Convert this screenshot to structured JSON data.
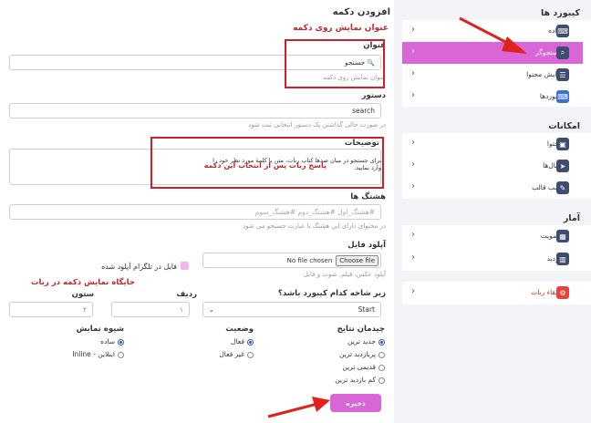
{
  "page": {
    "title": "افزودن دکمه"
  },
  "form": {
    "section_title": "عنوان نمایش روی دکمه",
    "title_label": "عنوان",
    "title_value": "جستجو",
    "title_emoji": "🔍",
    "title_hint": "عنوان نمایش روی دکمه",
    "command_label": "دستور",
    "command_value": "search",
    "command_hint": "در صورت خالی گذاشتن یک دستور انتخابی ثبت شود",
    "desc_label": "توضیحات",
    "desc_value": "برای جستجو در میان صدها کتاب ربات، متن یا کلمهٔ مورد نظر خود را وارد نمایید.",
    "desc_annotation": "پاسخ ربات پس از انتخاب این دکمه",
    "hashtag_label": "هشتگ ها",
    "hashtag_placeholder": "#هشتگ_اول #هشتگ_دوم #هشتگ_سوم",
    "hashtag_hint": "در محتوای دارای این هشتگ یا عبارت جستجو می شود",
    "upload_label": "آپلود فایل",
    "upload_button": "Choose file",
    "upload_status": "No file chosen",
    "upload_hint": "آپلود عکس، فیلم، صوت و فایل",
    "telegram_checkbox": "فایل در تلگرام آپلود شده",
    "subbranch_label": "زیر شاخه کدام کیبورد باشد؟",
    "subbranch_value": "Start",
    "position_annotation": "جایگاه نمایش دکمه در ربات",
    "row_label": "ردیف",
    "row_value": "۱",
    "col_label": "ستون",
    "col_value": "۲",
    "sort_label": "چیدمان نتایج",
    "sort_options": [
      "جدید ترین",
      "پربازدید ترین",
      "قدیمی ترین",
      "کم بازدید ترین"
    ],
    "status_label": "وضعیت",
    "status_options": [
      "فعال",
      "غیر فعال"
    ],
    "display_label": "شیوه نمایش",
    "display_options": [
      "ساده",
      "اینلاین - Inline"
    ],
    "save_button": "ذخیره"
  },
  "sidebar": {
    "keyboards_title": "کیبورد ها",
    "keyboards_items": [
      {
        "label": "ساده",
        "icon": "keyboard-icon"
      },
      {
        "label": "جستجوگر",
        "icon": "search-icon"
      },
      {
        "label": "نمایش محتوا",
        "icon": "list-icon"
      },
      {
        "label": "کیبوردها",
        "icon": "keyboard-icon"
      }
    ],
    "features_title": "امکانات",
    "features_items": [
      {
        "label": "محتوا",
        "icon": "image-icon"
      },
      {
        "label": "کانال‌ها",
        "icon": "send-icon"
      },
      {
        "label": "نصب قالب",
        "icon": "brush-icon"
      }
    ],
    "stats_title": "آمار",
    "stats_items": [
      {
        "label": "عضویت",
        "icon": "calendar-icon"
      },
      {
        "label": "بازدید",
        "icon": "chart-icon"
      },
      {
        "label": "ارتقاء ربات",
        "icon": "gear-icon"
      }
    ]
  },
  "colors": {
    "accent": "#d966d6",
    "annotation": "#c0272d",
    "icon_bg": "#3f4d6e",
    "radio": "#3657d3"
  }
}
